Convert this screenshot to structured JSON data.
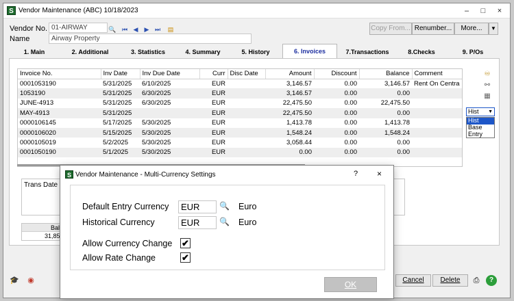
{
  "window": {
    "title": "Vendor Maintenance (ABC) 10/18/2023",
    "app_icon": "S",
    "controls": {
      "minimize": "–",
      "maximize": "□",
      "close": "×"
    }
  },
  "header": {
    "vendor_no_label": "Vendor No.",
    "vendor_no_value": "01-AIRWAY",
    "name_label": "Name",
    "name_value": "Airway Property",
    "buttons": {
      "copy_from": "Copy From...",
      "renumber": "Renumber...",
      "more": "More..."
    },
    "icons": [
      "search-icon",
      "first-record-icon",
      "previous-record-icon",
      "next-record-icon",
      "last-record-icon",
      "notes-icon"
    ]
  },
  "tabs": [
    {
      "label": "1. Main"
    },
    {
      "label": "2. Additional"
    },
    {
      "label": "3. Statistics"
    },
    {
      "label": "4. Summary"
    },
    {
      "label": "5. History"
    },
    {
      "label": "6. Invoices"
    },
    {
      "label": "7.Transactions"
    },
    {
      "label": "8.Checks"
    },
    {
      "label": "9. P/Os"
    }
  ],
  "active_tab": "6. Invoices",
  "invoices": {
    "columns": [
      "Invoice No.",
      "Inv Date",
      "Inv Due Date",
      "Curr",
      "Disc Date",
      "Amount",
      "Discount",
      "Balance",
      "Comment"
    ],
    "rows": [
      [
        "0001053190",
        "5/31/2025",
        "6/10/2025",
        "EUR",
        "",
        "3,146.57",
        "0.00",
        "3,146.57",
        "Rent On Centra"
      ],
      [
        "1053190",
        "5/31/2025",
        "6/30/2025",
        "EUR",
        "",
        "3,146.57",
        "0.00",
        "0.00",
        ""
      ],
      [
        "JUNE-4913",
        "5/31/2025",
        "6/30/2025",
        "EUR",
        "",
        "22,475.50",
        "0.00",
        "22,475.50",
        ""
      ],
      [
        "MAY-4913",
        "5/31/2025",
        "",
        "EUR",
        "",
        "22,475.50",
        "0.00",
        "0.00",
        ""
      ],
      [
        "0000106145",
        "5/17/2025",
        "5/30/2025",
        "EUR",
        "",
        "1,413.78",
        "0.00",
        "1,413.78",
        ""
      ],
      [
        "0000106020",
        "5/15/2025",
        "5/30/2025",
        "EUR",
        "",
        "1,548.24",
        "0.00",
        "1,548.24",
        ""
      ],
      [
        "0000105019",
        "5/2/2025",
        "5/30/2025",
        "EUR",
        "",
        "3,058.44",
        "0.00",
        "0.00",
        ""
      ],
      [
        "0001050190",
        "5/1/2025",
        "5/30/2025",
        "EUR",
        "",
        "0.00",
        "0.00",
        "0.00",
        ""
      ]
    ]
  },
  "currency_view": {
    "selected": "Hist",
    "options": [
      "Hist",
      "Base",
      "Entry"
    ]
  },
  "lower": {
    "trans_date_label": "Trans Date",
    "balance_label": "Bala",
    "balance_value": "31,850"
  },
  "bottom_buttons": {
    "cancel": "Cancel",
    "delete": "Delete"
  },
  "dialog": {
    "title": "Vendor Maintenance - Multi-Currency Settings",
    "help": "?",
    "close": "×",
    "default_entry_label": "Default Entry Currency",
    "default_entry_value": "EUR",
    "default_entry_name": "Euro",
    "historical_label": "Historical Currency",
    "historical_value": "EUR",
    "historical_name": "Euro",
    "allow_currency_change_label": "Allow Currency Change",
    "allow_currency_change": true,
    "allow_rate_change_label": "Allow Rate Change",
    "allow_rate_change": true,
    "check_mark": "✔",
    "ok_label": "OK"
  },
  "colors": {
    "accent": "#1d56c8",
    "active_tab_text": "#1d2fa0",
    "app_icon": "#1e6b2e"
  }
}
